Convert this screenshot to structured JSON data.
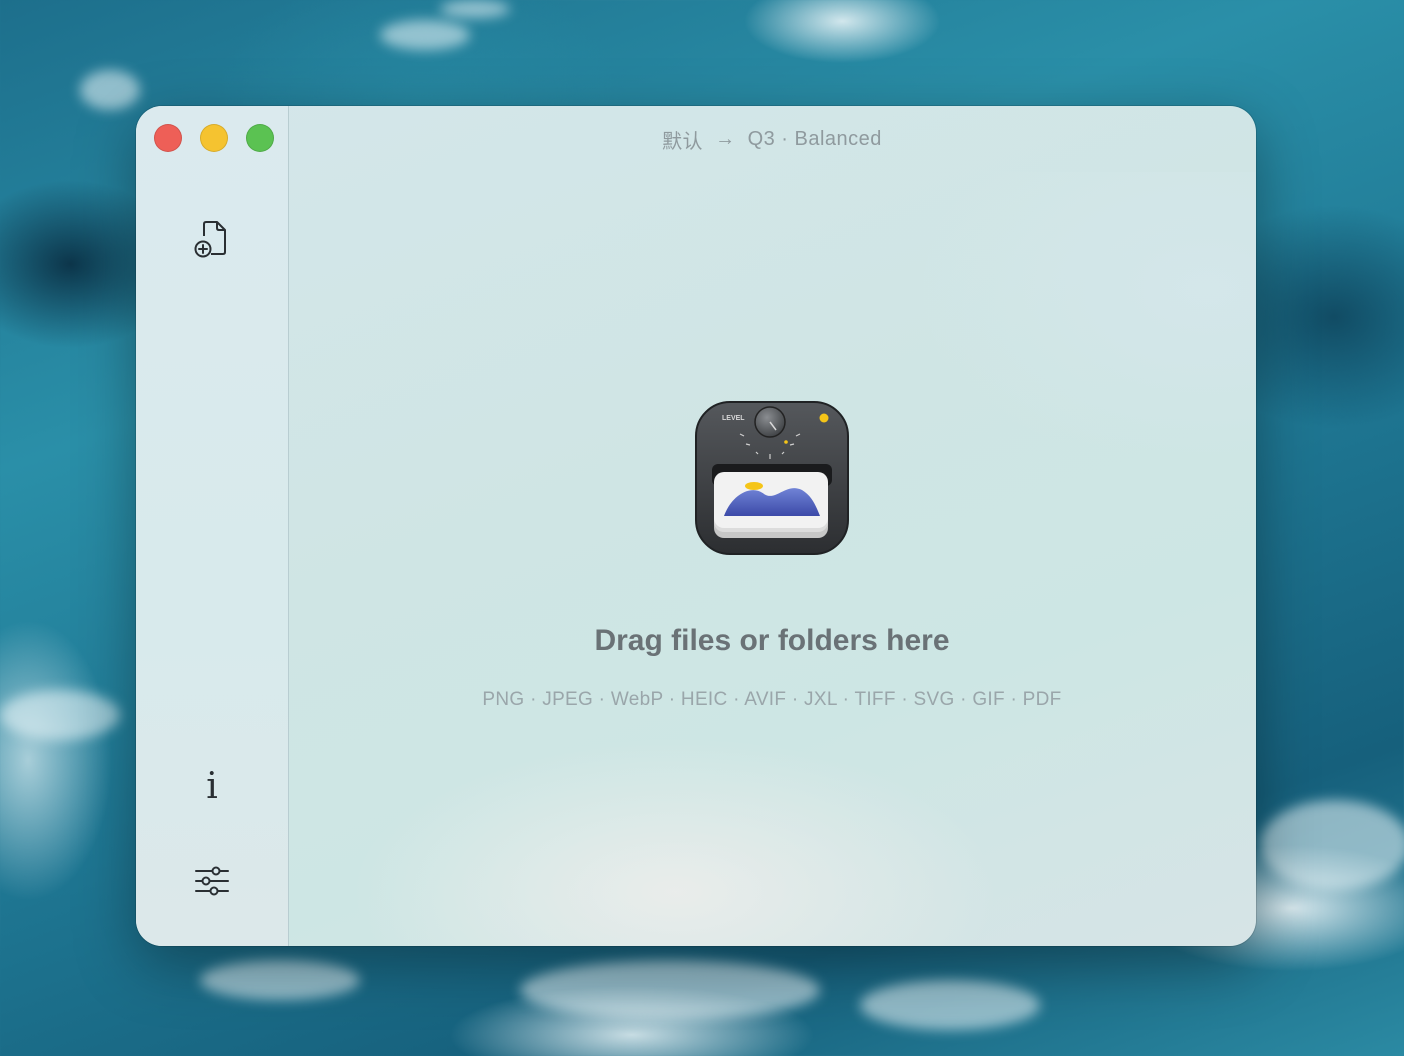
{
  "window": {
    "title_source": "默认",
    "title_arrow": "→",
    "title_target": "Q3 · Balanced"
  },
  "traffic_lights": {
    "close_color": "#ee5f57",
    "minimize_color": "#f5c330",
    "maximize_color": "#5bc252"
  },
  "sidebar": {
    "add_icon": "file-plus-icon",
    "info_glyph": "i",
    "info_icon": "info-icon",
    "settings_icon": "sliders-icon"
  },
  "main": {
    "app_icon": "image-compressor-app-icon",
    "app_icon_label": "LEVEL",
    "drop_title": "Drag files or folders here",
    "formats": "PNG · JPEG · WebP · HEIC · AVIF · JXL · TIFF · SVG · GIF · PDF"
  },
  "colors": {
    "accent_yellow": "#f5c518",
    "icon_body": "#3a3c3f",
    "image_blue": "#4a5bbd"
  }
}
